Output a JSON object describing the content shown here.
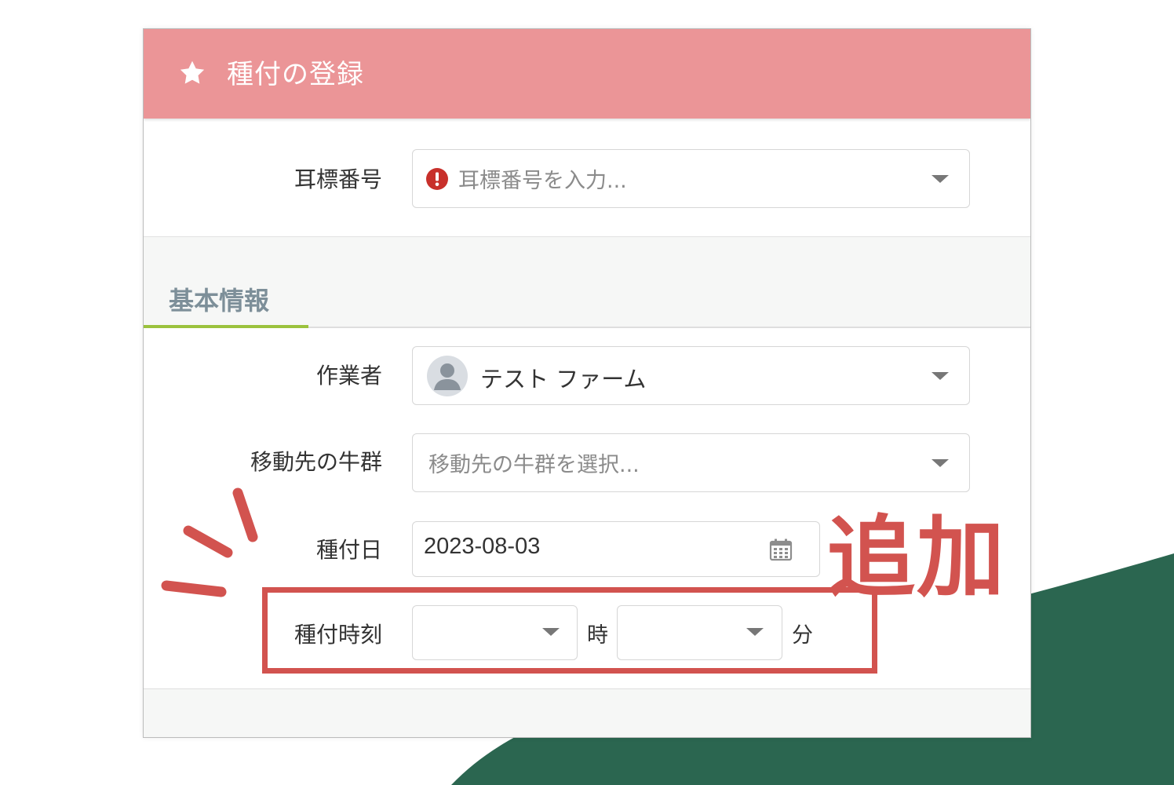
{
  "colors": {
    "header": "#eb9597",
    "accent_red": "#d2534f",
    "section_title": "#7d8f99",
    "section_underline": "#9bc23d",
    "background_green": "#2b6650"
  },
  "header": {
    "icon": "star-icon",
    "title": "種付の登録"
  },
  "ear_tag": {
    "label": "耳標番号",
    "icon": "exclamation-circle-icon",
    "placeholder": "耳標番号を入力..."
  },
  "basic_info": {
    "section_title": "基本情報",
    "worker": {
      "label": "作業者",
      "icon": "user-avatar-icon",
      "value": "テスト ファーム"
    },
    "destination_group": {
      "label": "移動先の牛群",
      "placeholder": "移動先の牛群を選択..."
    },
    "insemination_date": {
      "label": "種付日",
      "value": "2023-08-03",
      "icon": "calendar-icon"
    },
    "insemination_time": {
      "label": "種付時刻",
      "hour_unit": "時",
      "minute_unit": "分"
    }
  },
  "annotation": {
    "text": "追加"
  }
}
